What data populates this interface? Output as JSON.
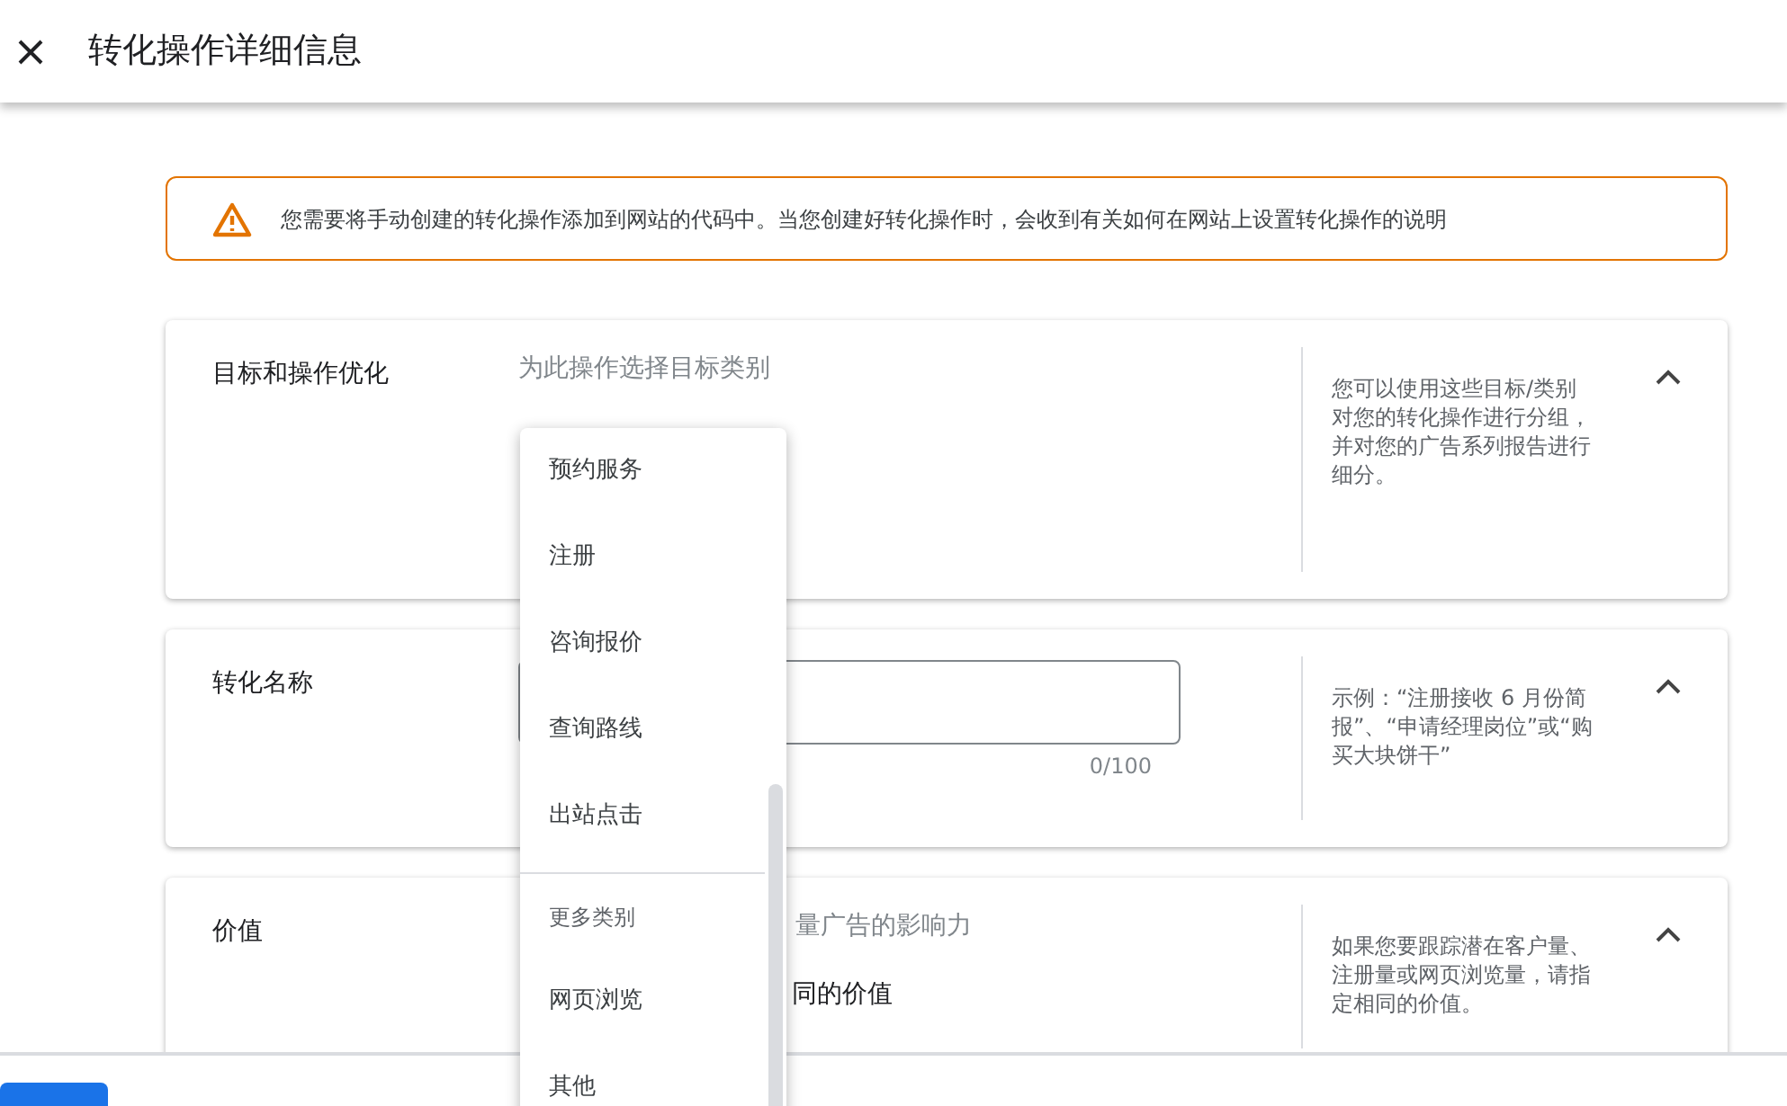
{
  "header": {
    "title": "转化操作详细信息"
  },
  "notice": {
    "text": "您需要将手动创建的转化操作添加到网站的代码中。当您创建好转化操作时，会收到有关如何在网站上设置转化操作的说明"
  },
  "cards": [
    {
      "kind": "goal",
      "label": "目标和操作优化",
      "hint": "为此操作选择目标类别",
      "help": "您可以使用这些目标/类别对您的转化操作进行分组，并对您的广告系列报告进行细分。",
      "expanded": true
    },
    {
      "kind": "name",
      "label": "转化名称",
      "counter": "0/100",
      "help": "示例：“注册接收 6 月份简报”、“申请经理岗位”或“购买大块饼干”",
      "expanded": true
    },
    {
      "kind": "value",
      "label": "价值",
      "hint": "量广告的影响力",
      "option": "同的价值",
      "help": "如果您要跟踪潜在客户量、注册量或网页浏览量，请指定相同的价值。",
      "expanded": true
    }
  ],
  "dropdown": {
    "items": [
      {
        "kind": "option",
        "label": "预约服务"
      },
      {
        "kind": "option",
        "label": "注册"
      },
      {
        "kind": "option",
        "label": "咨询报价"
      },
      {
        "kind": "option",
        "label": "查询路线"
      },
      {
        "kind": "option",
        "label": "出站点击"
      },
      {
        "kind": "heading",
        "label": "更多类别"
      },
      {
        "kind": "option",
        "label": "网页浏览"
      },
      {
        "kind": "option",
        "label": "其他"
      }
    ]
  }
}
